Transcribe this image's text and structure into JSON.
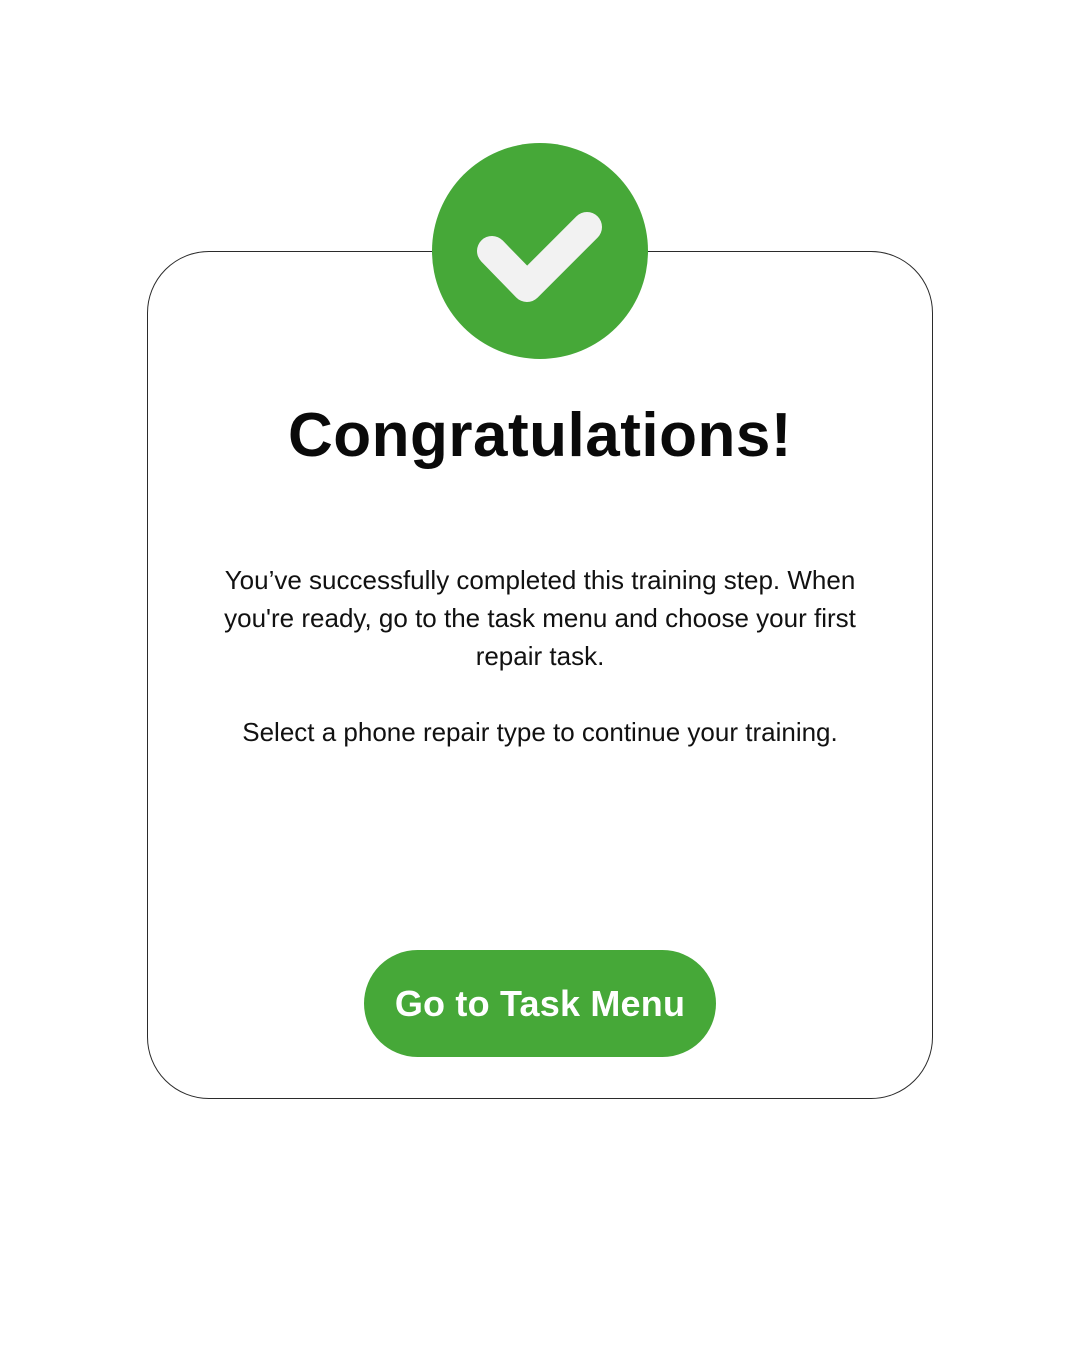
{
  "colors": {
    "accent": "#46a838",
    "check_mark": "#f2f2f2",
    "text": "#111111",
    "card_border": "#2b2b2b",
    "background": "#ffffff"
  },
  "badge": {
    "icon": "check-icon"
  },
  "dialog": {
    "title": "Congratulations!",
    "paragraphs": [
      "You’ve successfully completed this training step. When you're ready, go to the task menu and choose your first repair task.",
      "Select a phone repair type to continue your training."
    ],
    "button_label": "Go to Task Menu"
  }
}
